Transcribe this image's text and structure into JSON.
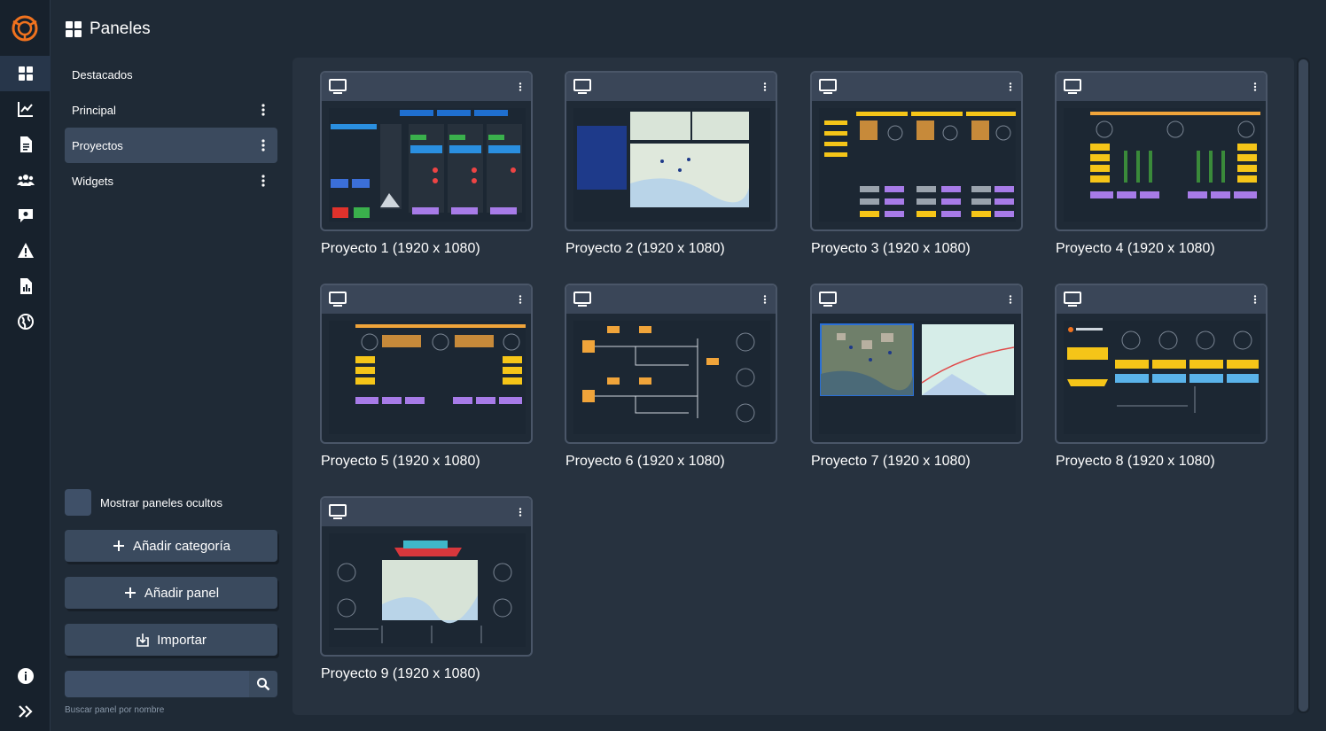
{
  "header": {
    "title": "Paneles",
    "icon": "grid-icon"
  },
  "rail": {
    "items": [
      {
        "icon": "dashboard-icon",
        "active": true
      },
      {
        "icon": "chart-line-icon"
      },
      {
        "icon": "document-icon"
      },
      {
        "icon": "users-icon"
      },
      {
        "icon": "chat-icon"
      },
      {
        "icon": "warning-icon"
      },
      {
        "icon": "report-icon"
      },
      {
        "icon": "globe-icon"
      }
    ],
    "bottom": [
      {
        "icon": "info-icon"
      },
      {
        "icon": "expand-icon"
      }
    ]
  },
  "categories": [
    {
      "label": "Destacados",
      "has_menu": false,
      "active": false
    },
    {
      "label": "Principal",
      "has_menu": true,
      "active": false
    },
    {
      "label": "Proyectos",
      "has_menu": true,
      "active": true
    },
    {
      "label": "Widgets",
      "has_menu": true,
      "active": false
    }
  ],
  "toggle_hidden": {
    "label": "Mostrar paneles ocultos",
    "checked": false
  },
  "buttons": {
    "add_category": "Añadir categoría",
    "add_panel": "Añadir panel",
    "import": "Importar"
  },
  "search": {
    "value": "",
    "hint": "Buscar panel por nombre"
  },
  "panels": [
    {
      "title": "Proyecto 1 (1920 x 1080)",
      "style": "scada"
    },
    {
      "title": "Proyecto 2 (1920 x 1080)",
      "style": "map"
    },
    {
      "title": "Proyecto 3 (1920 x 1080)",
      "style": "engines"
    },
    {
      "title": "Proyecto 4 (1920 x 1080)",
      "style": "gauges"
    },
    {
      "title": "Proyecto 5 (1920 x 1080)",
      "style": "generators"
    },
    {
      "title": "Proyecto 6 (1920 x 1080)",
      "style": "diagram"
    },
    {
      "title": "Proyecto 7 (1920 x 1080)",
      "style": "satellite"
    },
    {
      "title": "Proyecto 8 (1920 x 1080)",
      "style": "vessel"
    },
    {
      "title": "Proyecto 9 (1920 x 1080)",
      "style": "ship"
    }
  ],
  "colors": {
    "accent": "#f0721e",
    "yellow": "#f5c518",
    "purple": "#a77be8",
    "blue": "#2a6fd6",
    "active": "#3b4a5e"
  }
}
